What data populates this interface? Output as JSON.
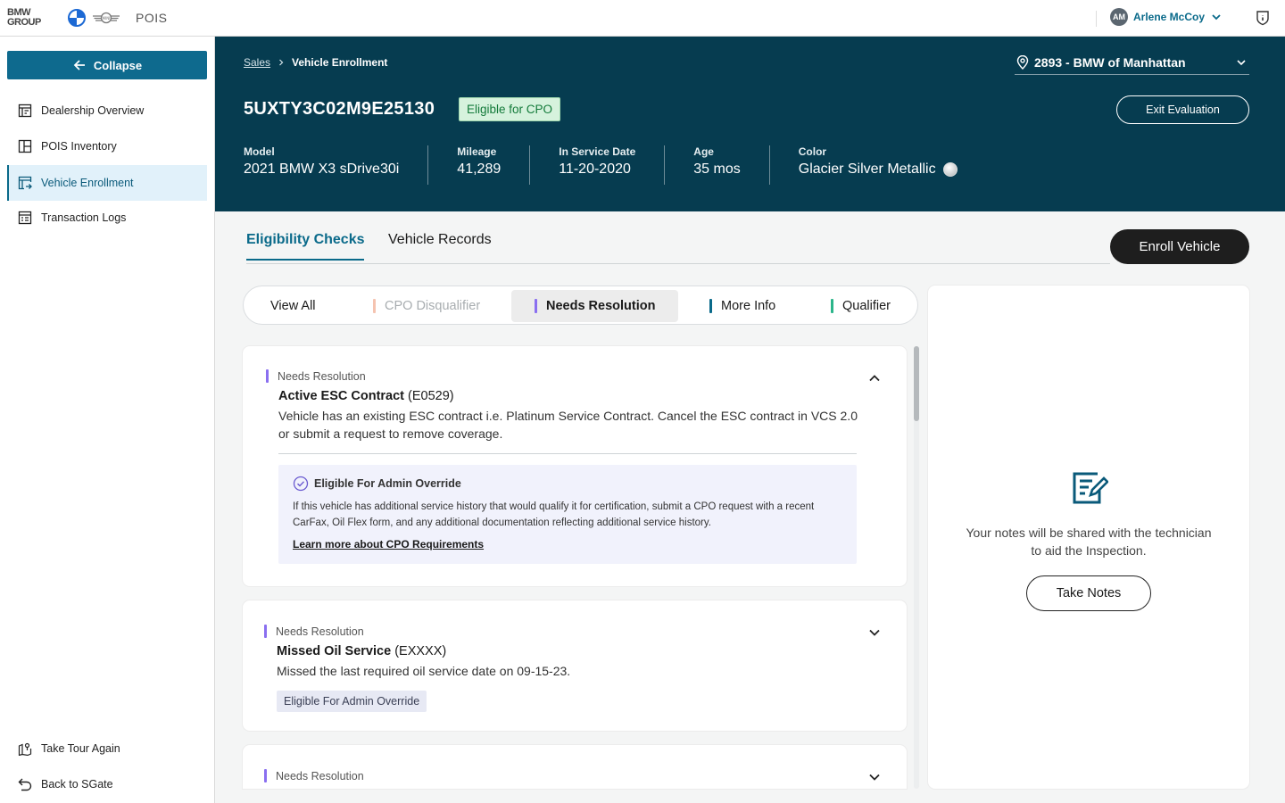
{
  "topbar": {
    "logo_text_line1": "BMW",
    "logo_text_line2": "GROUP",
    "app_name": "POIS",
    "user_initials": "AM",
    "user_name": "Arlene McCoy"
  },
  "sidebar": {
    "collapse_label": "Collapse",
    "items": [
      {
        "label": "Dealership Overview",
        "icon": "dashboard-icon"
      },
      {
        "label": "POIS Inventory",
        "icon": "inventory-icon"
      },
      {
        "label": "Vehicle Enrollment",
        "icon": "enrollment-icon",
        "active": true
      },
      {
        "label": "Transaction Logs",
        "icon": "logs-icon"
      }
    ],
    "bottom_items": [
      {
        "label": "Take Tour Again",
        "icon": "map-pin-icon"
      },
      {
        "label": "Back to SGate",
        "icon": "back-arrow-icon"
      }
    ]
  },
  "header": {
    "breadcrumb_parent": "Sales",
    "breadcrumb_current": "Vehicle Enrollment",
    "dealer": "2893 - BMW of Manhattan",
    "vin": "5UXTY3C02M9E25130",
    "badge": "Eligible for CPO",
    "exit_label": "Exit Evaluation",
    "specs": [
      {
        "label": "Model",
        "value": "2021 BMW X3 sDrive30i"
      },
      {
        "label": "Mileage",
        "value": "41,289"
      },
      {
        "label": "In Service Date",
        "value": "11-20-2020"
      },
      {
        "label": "Age",
        "value": "35 mos"
      },
      {
        "label": "Color",
        "value": "Glacier Silver Metallic"
      }
    ]
  },
  "tabs": {
    "items": [
      "Eligibility Checks",
      "Vehicle Records"
    ],
    "active": "Eligibility Checks",
    "enroll_label": "Enroll Vehicle"
  },
  "filters": {
    "items": [
      {
        "label": "View All",
        "color": ""
      },
      {
        "label": "CPO Disqualifier",
        "color": "#f5c3b0",
        "disabled": true
      },
      {
        "label": "Needs Resolution",
        "color": "#8a6ff0",
        "active": true
      },
      {
        "label": "More Info",
        "color": "#0a6a8a"
      },
      {
        "label": "Qualifier",
        "color": "#2bb58a"
      }
    ]
  },
  "cards": [
    {
      "category": "Needs Resolution",
      "title": "Active ESC Contract",
      "code": "(E0529)",
      "description": "Vehicle has an existing ESC contract i.e. Platinum Service Contract. Cancel the ESC contract in VCS 2.0 or submit a request to remove coverage.",
      "override_title": "Eligible For Admin Override",
      "override_text": "If this vehicle has additional service history that would qualify it for certification, submit a CPO request with a recent CarFax, Oil Flex form, and any additional documentation reflecting additional service history.",
      "override_link": "Learn more about CPO Requirements"
    },
    {
      "category": "Needs Resolution",
      "title": "Missed Oil Service",
      "code": "(EXXXX)",
      "description": "Missed the last required oil service date on 09-15-23.",
      "chip": "Eligible For Admin Override"
    },
    {
      "category": "Needs Resolution"
    }
  ],
  "notes": {
    "text": "Your notes will be shared with the technician to aid the Inspection.",
    "button": "Take Notes"
  }
}
